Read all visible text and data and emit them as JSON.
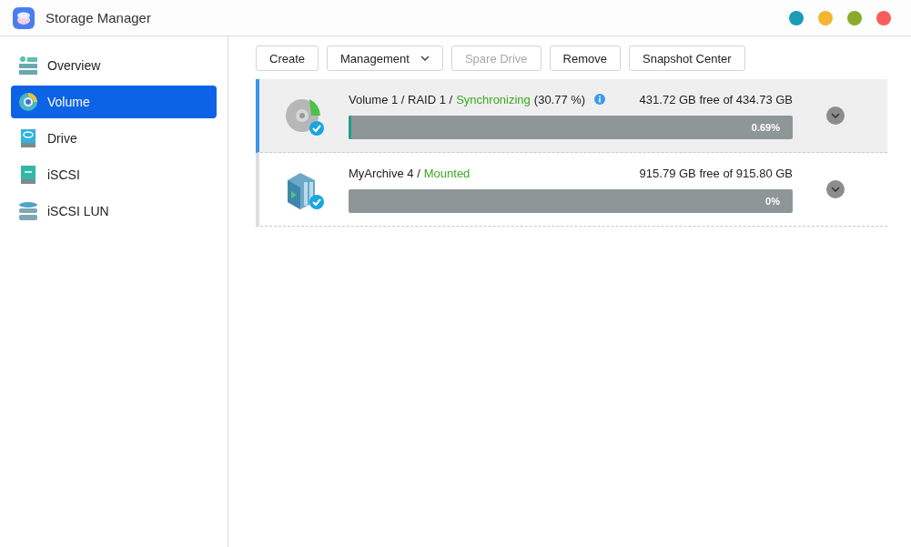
{
  "window": {
    "title": "Storage Manager",
    "controls": [
      {
        "color": "#1a9bb8"
      },
      {
        "color": "#f2b632"
      },
      {
        "color": "#8aab2a"
      },
      {
        "color": "#fc5c5c"
      }
    ]
  },
  "sidebar": {
    "items": [
      {
        "label": "Overview",
        "kind": "overview",
        "selected": false
      },
      {
        "label": "Volume",
        "kind": "volume",
        "selected": true
      },
      {
        "label": "Drive",
        "kind": "drive",
        "selected": false
      },
      {
        "label": "iSCSI",
        "kind": "iscsi",
        "selected": false
      },
      {
        "label": "iSCSI LUN",
        "kind": "lun",
        "selected": false
      }
    ]
  },
  "toolbar": {
    "buttons": [
      {
        "label": "Create",
        "kind": "plain",
        "disabled": false
      },
      {
        "label": "Management",
        "kind": "dropdown",
        "disabled": false
      },
      {
        "label": "Spare Drive",
        "kind": "plain",
        "disabled": true
      },
      {
        "label": "Remove",
        "kind": "plain",
        "disabled": false
      },
      {
        "label": "Snapshot Center",
        "kind": "plain",
        "disabled": false
      }
    ]
  },
  "volumes": [
    {
      "kind": "disk",
      "title": "Volume 1 / RAID 1 /",
      "status": "Synchronizing",
      "status_detail": "(30.77 %)",
      "info": true,
      "capacity": "431.72 GB free of 434.73 GB",
      "level": 0.0069,
      "reading": "0.69%",
      "selected": true
    },
    {
      "kind": "archive",
      "title": "MyArchive 4 /",
      "status": "Mounted",
      "capacity": "915.79 GB free of 915.80 GB",
      "reading": "0%",
      "selected": false
    }
  ]
}
